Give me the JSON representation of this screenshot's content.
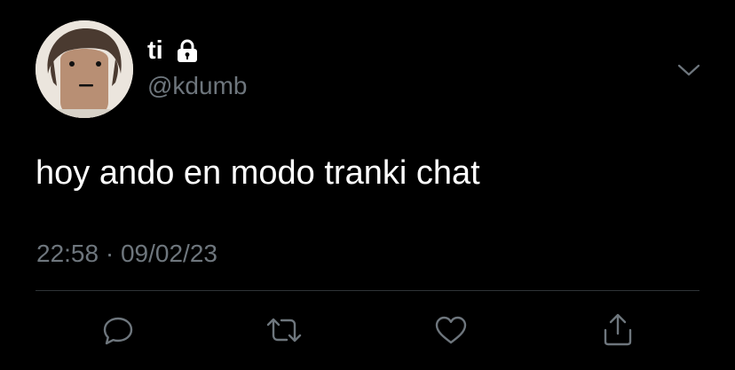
{
  "author": {
    "display_name": "ti",
    "handle": "@kdumb",
    "protected_icon": "lock-icon"
  },
  "tweet": {
    "text": "hoy ando en modo tranki chat",
    "time": "22:58",
    "separator": "·",
    "date": "09/02/23"
  },
  "menu": {
    "icon": "chevron-down-icon"
  },
  "actions": [
    {
      "icon": "reply-icon"
    },
    {
      "icon": "retweet-icon"
    },
    {
      "icon": "like-icon"
    },
    {
      "icon": "share-icon"
    }
  ],
  "colors": {
    "background": "#000000",
    "primary_text": "#ffffff",
    "secondary_text": "#6e767d",
    "divider": "#2f3336",
    "icon": "#6e767d"
  }
}
